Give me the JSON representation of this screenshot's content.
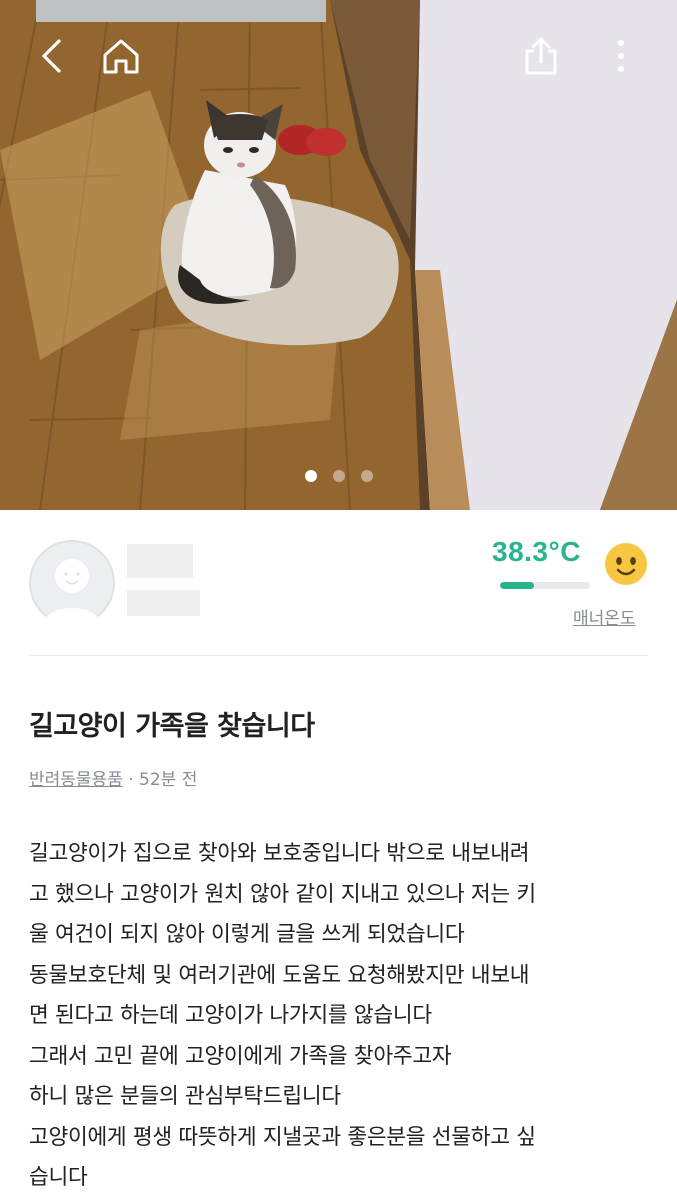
{
  "photo": {
    "alt": "",
    "page_indicator": {
      "count": 3,
      "active": 0
    }
  },
  "topbar": {
    "back_icon": "chevron-left-icon",
    "home_icon": "home-icon",
    "share_icon": "share-icon",
    "more_icon": "more-vertical-icon"
  },
  "profile": {
    "temperature": "38.3°C",
    "temperature_level": 0.383,
    "manner_label": "매너온도",
    "accent_color": "#2ab38f"
  },
  "post": {
    "title": "길고양이 가족을 찾습니다",
    "category": "반려동물용품",
    "time": " · 52분 전",
    "body_lines": [
      "길고양이가 집으로 찾아와 보호중입니다 밖으로 내보내려",
      "고 했으나 고양이가 원치 않아 같이 지내고 있으나 저는 키",
      "울 여건이 되지 않아 이렇게 글을 쓰게 되었습니다",
      "동물보호단체 및 여러기관에 도움도 요청해봤지만 내보내",
      "면 된다고 하는데 고양이가 나가지를 않습니다",
      "그래서 고민 끝에 고양이에게 가족을 찾아주고자",
      "하니 많은 분들의 관심부탁드립니다",
      "고양이에게 평생 따뜻하게 지낼곳과 좋은분을 선물하고 싶",
      "습니다"
    ]
  }
}
